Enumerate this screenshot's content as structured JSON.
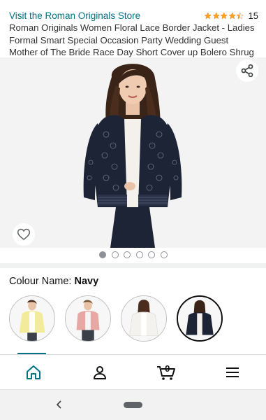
{
  "store_link": "Visit the Roman Originals Store",
  "rating": {
    "stars": 4.5,
    "count": "15",
    "star_color": "#ffa41c"
  },
  "product_title": "Roman Originals Women Floral Lace Border Jacket - Ladies Formal Smart Special Occasion Party Wedding Guest Mother of The Bride Race Day Short Cover up Bolero Shrug Cardigan",
  "gallery": {
    "image_count": 6,
    "active_index": 0
  },
  "colour": {
    "label": "Colour Name: ",
    "value": "Navy"
  },
  "swatches": [
    {
      "name": "Yellow",
      "color": "#f2ec9a"
    },
    {
      "name": "Pink",
      "color": "#e7a7a2"
    },
    {
      "name": "White",
      "color": "#f4f2ee"
    },
    {
      "name": "Navy",
      "color": "#1d2436",
      "selected": true
    }
  ],
  "bottom_nav": [
    "home-icon",
    "account-icon",
    "cart-icon",
    "menu-icon"
  ],
  "cart_count": "0",
  "accent_color": "#007185"
}
